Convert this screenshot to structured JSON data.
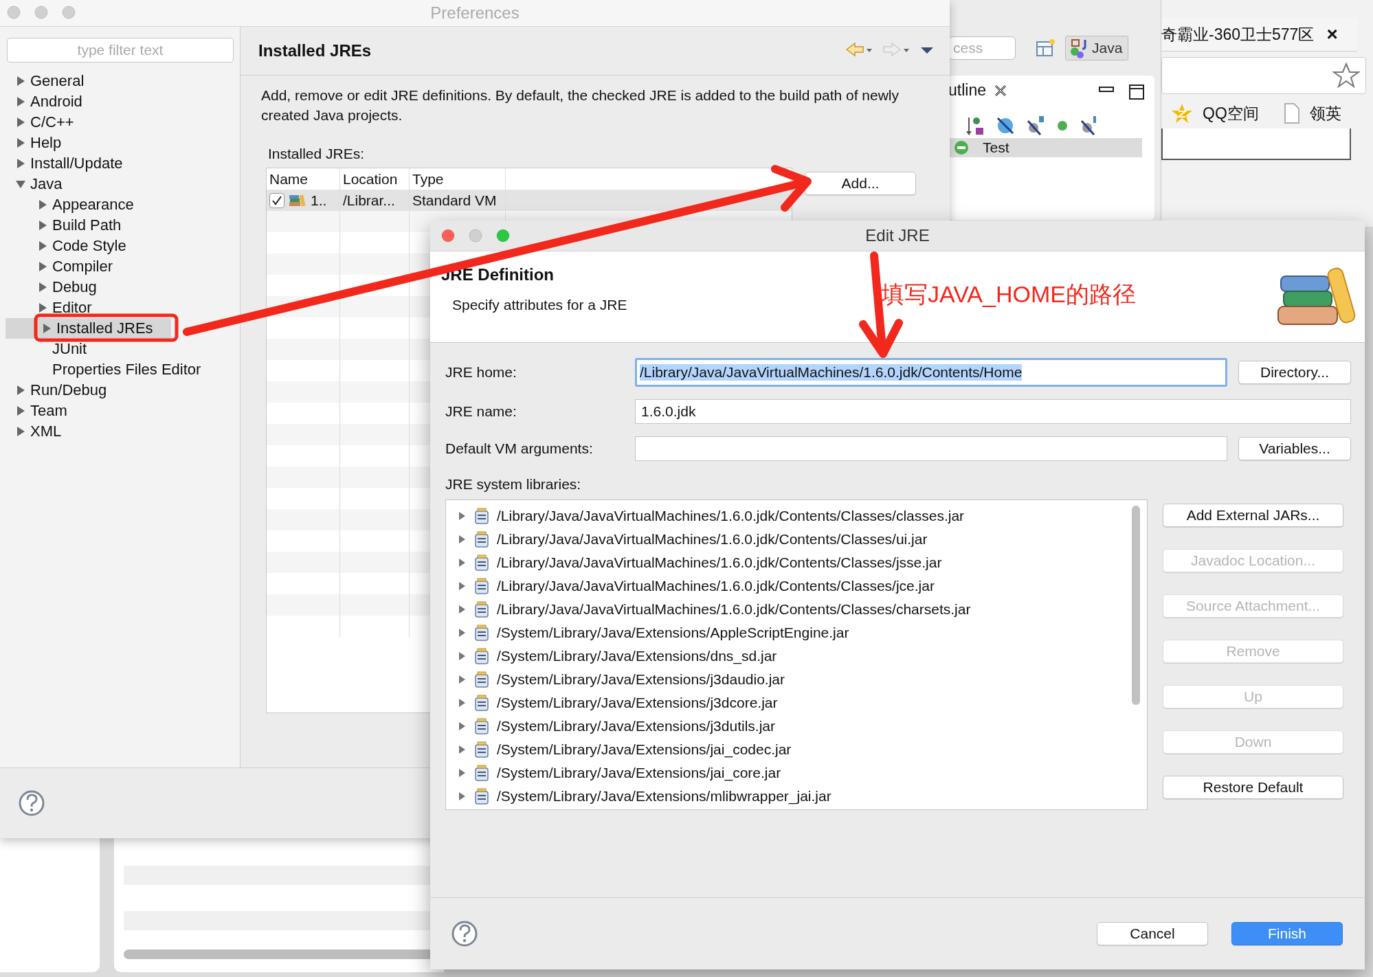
{
  "preferences": {
    "title": "Preferences",
    "filter": {
      "placeholder": "type filter text"
    },
    "tree": [
      {
        "label": "General",
        "kind": "folder",
        "expanded": false,
        "selected": false
      },
      {
        "label": "Android",
        "kind": "folder",
        "expanded": false,
        "selected": false
      },
      {
        "label": "C/C++",
        "kind": "folder",
        "expanded": false,
        "selected": false
      },
      {
        "label": "Help",
        "kind": "folder",
        "expanded": false,
        "selected": false
      },
      {
        "label": "Install/Update",
        "kind": "folder",
        "expanded": false,
        "selected": false
      },
      {
        "label": "Java",
        "kind": "folder",
        "expanded": true,
        "selected": false,
        "children": [
          {
            "label": "Appearance",
            "kind": "folder",
            "expanded": false,
            "selected": false
          },
          {
            "label": "Build Path",
            "kind": "folder",
            "expanded": false,
            "selected": false
          },
          {
            "label": "Code Style",
            "kind": "folder",
            "expanded": false,
            "selected": false
          },
          {
            "label": "Compiler",
            "kind": "folder",
            "expanded": false,
            "selected": false
          },
          {
            "label": "Debug",
            "kind": "folder",
            "expanded": false,
            "selected": false
          },
          {
            "label": "Editor",
            "kind": "folder",
            "expanded": false,
            "selected": false
          },
          {
            "label": "Installed JREs",
            "kind": "folder",
            "expanded": false,
            "selected": true
          },
          {
            "label": "JUnit",
            "kind": "leaf",
            "selected": false
          },
          {
            "label": "Properties Files Editor",
            "kind": "leaf",
            "selected": false
          }
        ]
      },
      {
        "label": "Run/Debug",
        "kind": "folder",
        "expanded": false,
        "selected": false
      },
      {
        "label": "Team",
        "kind": "folder",
        "expanded": false,
        "selected": false
      },
      {
        "label": "XML",
        "kind": "folder",
        "expanded": false,
        "selected": false
      }
    ],
    "page": {
      "title": "Installed JREs",
      "description": "Add, remove or edit JRE definitions. By default, the checked JRE is added to the build path of newly created Java projects.",
      "list_label": "Installed JREs:",
      "table": {
        "columns": [
          "Name",
          "Location",
          "Type"
        ],
        "rows": [
          {
            "checked": true,
            "name": "1..",
            "location": "/Librar...",
            "type": "Standard VM"
          }
        ]
      },
      "buttons": [
        "Add..."
      ]
    }
  },
  "background_ide": {
    "quick_access": {
      "placeholder": "cess"
    },
    "perspective": "Java",
    "outline": {
      "tab": "utline",
      "rows": [
        {
          "label": "Test",
          "selected": true
        }
      ]
    }
  },
  "browser": {
    "tab_title": "奇霸业-360卫士577区",
    "close": "×",
    "bookmarks": [
      "QQ空间",
      "领英"
    ]
  },
  "edit_jre": {
    "title": "Edit JRE",
    "header_title": "JRE Definition",
    "header_subtitle": "Specify attributes for a JRE",
    "fields": [
      {
        "label": "JRE home:",
        "value": "/Library/Java/JavaVirtualMachines/1.6.0.jdk/Contents/Home",
        "focused": true,
        "button": "Directory..."
      },
      {
        "label": "JRE name:",
        "value": "1.6.0.jdk",
        "focused": false
      },
      {
        "label": "Default VM arguments:",
        "focused": false,
        "button": "Variables..."
      }
    ],
    "libraries_label": "JRE system libraries:",
    "libraries": [
      "/Library/Java/JavaVirtualMachines/1.6.0.jdk/Contents/Classes/classes.jar",
      "/Library/Java/JavaVirtualMachines/1.6.0.jdk/Contents/Classes/ui.jar",
      "/Library/Java/JavaVirtualMachines/1.6.0.jdk/Contents/Classes/jsse.jar",
      "/Library/Java/JavaVirtualMachines/1.6.0.jdk/Contents/Classes/jce.jar",
      "/Library/Java/JavaVirtualMachines/1.6.0.jdk/Contents/Classes/charsets.jar",
      "/System/Library/Java/Extensions/AppleScriptEngine.jar",
      "/System/Library/Java/Extensions/dns_sd.jar",
      "/System/Library/Java/Extensions/j3daudio.jar",
      "/System/Library/Java/Extensions/j3dcore.jar",
      "/System/Library/Java/Extensions/j3dutils.jar",
      "/System/Library/Java/Extensions/jai_codec.jar",
      "/System/Library/Java/Extensions/jai_core.jar",
      "/System/Library/Java/Extensions/mlibwrapper_jai.jar"
    ],
    "side_buttons": [
      {
        "label": "Add External JARs...",
        "disabled": false
      },
      {
        "label": "Javadoc Location...",
        "disabled": true
      },
      {
        "label": "Source Attachment...",
        "disabled": true
      },
      {
        "label": "Remove",
        "disabled": true
      },
      {
        "label": "Up",
        "disabled": true
      },
      {
        "label": "Down",
        "disabled": true
      },
      {
        "label": "Restore Default",
        "disabled": false
      }
    ],
    "buttons": [
      {
        "label": "Cancel",
        "primary": false
      },
      {
        "label": "Finish",
        "primary": true
      }
    ]
  },
  "annotation": {
    "text": "填写JAVA_HOME的路径"
  }
}
